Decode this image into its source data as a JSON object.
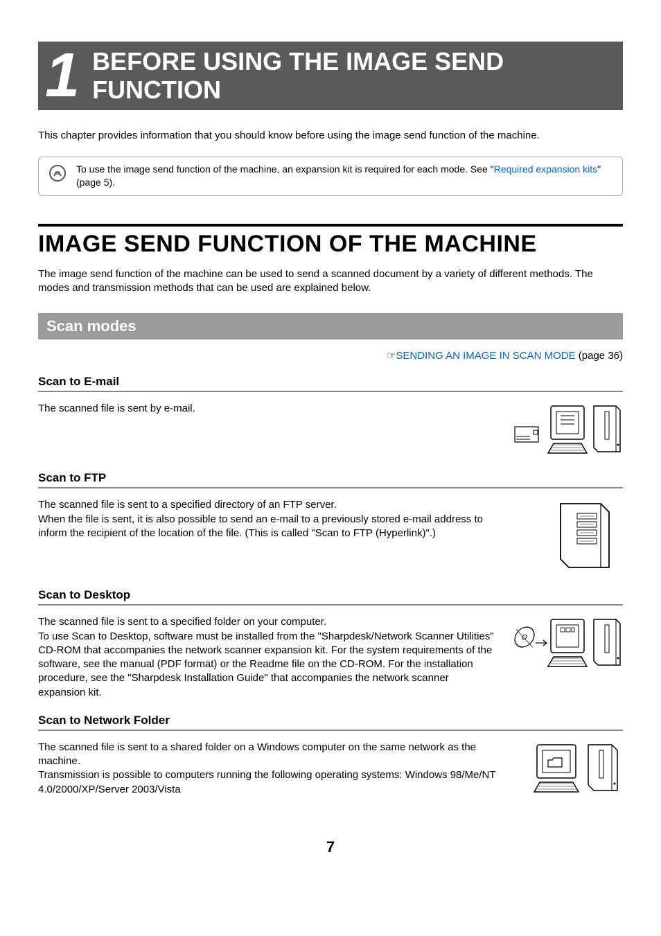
{
  "chapter": {
    "number": "1",
    "title": "BEFORE USING THE IMAGE SEND FUNCTION"
  },
  "intro": "This chapter provides information that you should know before using the image send function of the machine.",
  "note": {
    "prefix": "To use the image send function of the machine, an expansion kit is required for each mode. See \"",
    "link": "Required expansion kits",
    "suffix": "\" (page 5)."
  },
  "section1": {
    "title": "IMAGE SEND FUNCTION OF THE MACHINE",
    "body": "The image send function of the machine can be used to send a scanned document by a variety of different methods. The modes and transmission methods that can be used are explained below."
  },
  "scan_modes": {
    "heading": "Scan modes",
    "xref_symbol": "☞",
    "xref_link": "SENDING AN IMAGE IN SCAN MODE",
    "xref_page": " (page 36)"
  },
  "subs": {
    "email": {
      "title": "Scan to E-mail",
      "body": "The scanned file is sent by e-mail."
    },
    "ftp": {
      "title": "Scan to FTP",
      "body": "The scanned file is sent to a specified directory of an FTP server.\nWhen the file is sent, it is also possible to send an e-mail to a previously stored e-mail address to inform the recipient of the location of the file. (This is called \"Scan to FTP (Hyperlink)\".)"
    },
    "desktop": {
      "title": "Scan to Desktop",
      "body": "The scanned file is sent to a specified folder on your computer.\nTo use Scan to Desktop, software must be installed from the \"Sharpdesk/Network Scanner Utilities\" CD-ROM that accompanies the network scanner expansion kit. For the system requirements of the software, see the manual (PDF format) or the Readme file on the CD-ROM. For the installation procedure, see the \"Sharpdesk Installation Guide\" that accompanies the network scanner expansion kit."
    },
    "network": {
      "title": "Scan to Network Folder",
      "body": "The scanned file is sent to a shared folder on a Windows computer on the same network as the machine.\nTransmission is possible to computers running the following operating systems: Windows 98/Me/NT 4.0/2000/XP/Server 2003/Vista"
    }
  },
  "page_number": "7"
}
